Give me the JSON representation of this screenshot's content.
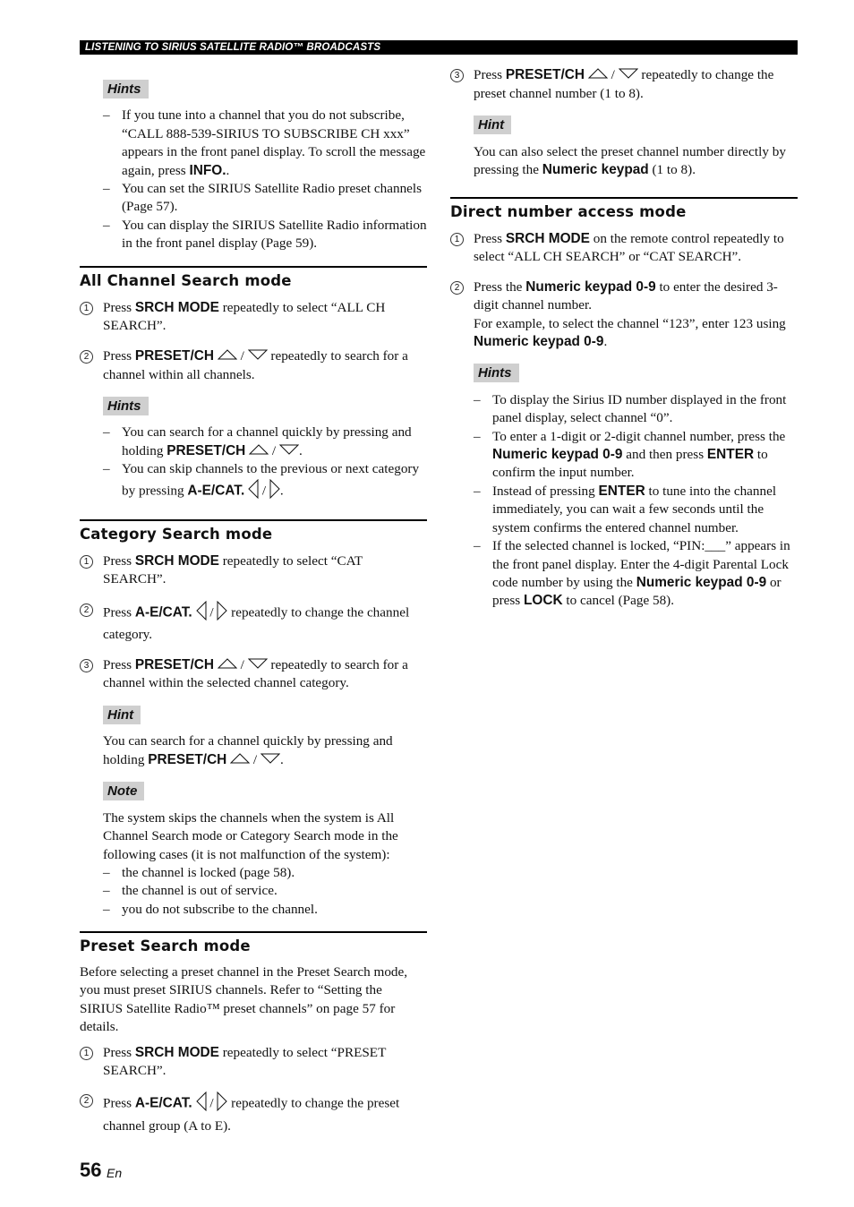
{
  "header": {
    "title": "LISTENING TO SIRIUS SATELLITE RADIO™ BROADCASTS"
  },
  "footer": {
    "page_number": "56",
    "language": "En"
  },
  "icons": {
    "up": "triangle-up-icon",
    "down": "triangle-down-icon",
    "left": "triangle-left-icon",
    "right": "triangle-right-icon"
  },
  "left_column": {
    "hints_top": {
      "label": "Hints",
      "items": [
        [
          {
            "t": "If you tune into a channel that you do not subscribe, “CALL 888-539-SIRIUS TO SUBSCRIBE CH xxx” appears in the front panel display. To scroll the message again, press "
          },
          {
            "b": "INFO."
          },
          {
            "t": "."
          }
        ],
        [
          {
            "t": "You can set the SIRIUS Satellite Radio preset channels (Page 57)."
          }
        ],
        [
          {
            "t": "You can display the SIRIUS Satellite Radio information in the front panel display (Page 59)."
          }
        ]
      ]
    },
    "all_channel": {
      "title": "All Channel Search mode",
      "steps": [
        {
          "num": "1",
          "runs": [
            {
              "t": "Press "
            },
            {
              "b": "SRCH MODE"
            },
            {
              "t": " repeatedly to select “ALL CH SEARCH”."
            }
          ]
        },
        {
          "num": "2",
          "runs": [
            {
              "t": "Press "
            },
            {
              "b": "PRESET/CH"
            },
            {
              "t": " "
            },
            {
              "i": "up"
            },
            {
              "t": " / "
            },
            {
              "i": "down"
            },
            {
              "t": " repeatedly to search for a channel within all channels."
            }
          ]
        }
      ],
      "hints": {
        "label": "Hints",
        "items": [
          [
            {
              "t": "You can search for a channel quickly by pressing and holding "
            },
            {
              "b": "PRESET/CH"
            },
            {
              "t": " "
            },
            {
              "i": "up"
            },
            {
              "t": " / "
            },
            {
              "i": "down"
            },
            {
              "t": "."
            }
          ],
          [
            {
              "t": "You can skip channels to the previous or next category by pressing "
            },
            {
              "b": "A-E/CAT."
            },
            {
              "t": " "
            },
            {
              "i": "left"
            },
            {
              "t": " / "
            },
            {
              "i": "right"
            },
            {
              "t": "."
            }
          ]
        ]
      }
    },
    "category": {
      "title": "Category Search mode",
      "steps": [
        {
          "num": "1",
          "runs": [
            {
              "t": "Press "
            },
            {
              "b": "SRCH MODE"
            },
            {
              "t": " repeatedly to select “CAT SEARCH”."
            }
          ]
        },
        {
          "num": "2",
          "runs": [
            {
              "t": "Press "
            },
            {
              "b": "A-E/CAT."
            },
            {
              "t": " "
            },
            {
              "i": "left"
            },
            {
              "t": " / "
            },
            {
              "i": "right"
            },
            {
              "t": " repeatedly to change the channel category."
            }
          ]
        },
        {
          "num": "3",
          "runs": [
            {
              "t": "Press "
            },
            {
              "b": "PRESET/CH"
            },
            {
              "t": " "
            },
            {
              "i": "up"
            },
            {
              "t": " / "
            },
            {
              "i": "down"
            },
            {
              "t": " repeatedly to search for a channel within the selected channel category."
            }
          ]
        }
      ],
      "hint": {
        "label": "Hint",
        "runs": [
          {
            "t": "You can search for a channel quickly by pressing and holding "
          },
          {
            "b": "PRESET/CH"
          },
          {
            "t": " "
          },
          {
            "i": "up"
          },
          {
            "t": " / "
          },
          {
            "i": "down"
          },
          {
            "t": "."
          }
        ]
      },
      "note": {
        "label": "Note",
        "text": "The system skips the channels when the system is All Channel Search mode or Category Search mode in the following cases (it is not malfunction of the system):",
        "items": [
          [
            {
              "t": "the channel is locked (page 58)."
            }
          ],
          [
            {
              "t": "the channel is out of service."
            }
          ],
          [
            {
              "t": "you do not subscribe to the channel."
            }
          ]
        ]
      }
    },
    "preset": {
      "title": "Preset Search mode",
      "intro": "Before selecting a preset channel in the Preset Search mode, you must preset SIRIUS channels. Refer to “Setting the SIRIUS Satellite Radio™ preset channels” on page 57 for details.",
      "steps": [
        {
          "num": "1",
          "runs": [
            {
              "t": "Press "
            },
            {
              "b": "SRCH MODE"
            },
            {
              "t": " repeatedly to select “PRESET SEARCH”."
            }
          ]
        },
        {
          "num": "2",
          "runs": [
            {
              "t": "Press "
            },
            {
              "b": "A-E/CAT."
            },
            {
              "t": " "
            },
            {
              "i": "left"
            },
            {
              "t": " / "
            },
            {
              "i": "right"
            },
            {
              "t": " repeatedly to change the preset channel group (A to E)."
            }
          ]
        }
      ]
    }
  },
  "right_column": {
    "preset_cont": {
      "steps": [
        {
          "num": "3",
          "runs": [
            {
              "t": "Press "
            },
            {
              "b": "PRESET/CH"
            },
            {
              "t": " "
            },
            {
              "i": "up"
            },
            {
              "t": " / "
            },
            {
              "i": "down"
            },
            {
              "t": " repeatedly to change the preset channel number (1 to 8)."
            }
          ]
        }
      ],
      "hint": {
        "label": "Hint",
        "runs": [
          {
            "t": "You can also select the preset channel number directly by pressing the "
          },
          {
            "b": "Numeric keypad"
          },
          {
            "t": " (1 to 8)."
          }
        ]
      }
    },
    "direct": {
      "title": "Direct number access mode",
      "steps": [
        {
          "num": "1",
          "runs": [
            {
              "t": "Press "
            },
            {
              "b": "SRCH MODE"
            },
            {
              "t": " on the remote control repeatedly to select “ALL CH SEARCH” or “CAT SEARCH”."
            }
          ]
        },
        {
          "num": "2",
          "runs": [
            {
              "t": "Press the "
            },
            {
              "b": "Numeric keypad 0-9"
            },
            {
              "t": " to enter the desired 3-digit channel number."
            },
            {
              "br": true
            },
            {
              "t": "For example, to select the channel “123”, enter 123 using "
            },
            {
              "b": "Numeric keypad 0-9"
            },
            {
              "t": "."
            }
          ]
        }
      ],
      "hints": {
        "label": "Hints",
        "items": [
          [
            {
              "t": "To display the Sirius ID number displayed in the front panel display, select channel “0”."
            }
          ],
          [
            {
              "t": "To enter a 1-digit or 2-digit channel number, press the "
            },
            {
              "b": "Numeric keypad 0-9"
            },
            {
              "t": " and then press "
            },
            {
              "b": "ENTER"
            },
            {
              "t": " to confirm the input number."
            }
          ],
          [
            {
              "t": "Instead of pressing "
            },
            {
              "b": "ENTER"
            },
            {
              "t": " to tune into the channel immediately, you can wait a few seconds until the system confirms the entered channel number."
            }
          ],
          [
            {
              "t": "If the selected channel is locked, “PIN:___” appears in the front panel display. Enter the 4-digit Parental Lock code number by using the "
            },
            {
              "b": "Numeric keypad 0-9"
            },
            {
              "t": " or press "
            },
            {
              "b": "LOCK"
            },
            {
              "t": " to cancel (Page 58)."
            }
          ]
        ]
      }
    }
  }
}
